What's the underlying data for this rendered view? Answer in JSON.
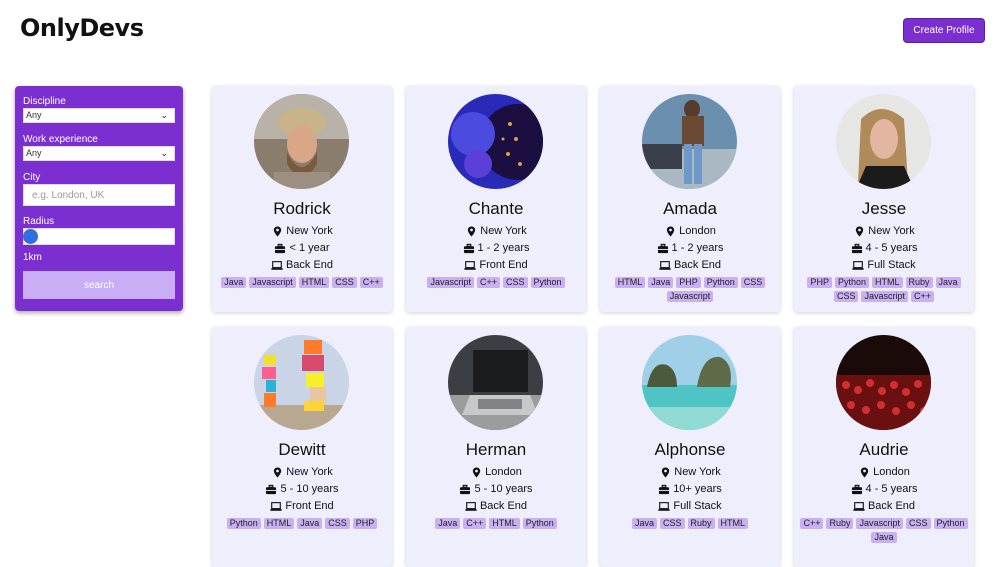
{
  "app": {
    "logo": "OnlyDevs",
    "create_button": "Create Profile"
  },
  "filters": {
    "discipline_label": "Discipline",
    "discipline_value": "Any",
    "experience_label": "Work experience",
    "experience_value": "Any",
    "city_label": "City",
    "city_placeholder": "e.g. London, UK",
    "radius_label": "Radius",
    "radius_value": "1km",
    "radius_slider_fraction": 0.0,
    "search_button": "search"
  },
  "colors": {
    "accent": "#7b2fd0",
    "card_bg": "#eeeefd",
    "tag_bg": "#c9b0f2",
    "search_disabled": "#c9adf5",
    "slider_knob": "#2f6fe0"
  },
  "icons": {
    "location": "map-pin-icon",
    "experience": "briefcase-icon",
    "discipline": "laptop-icon",
    "dropdown": "chevron-down-icon"
  },
  "profiles": [
    {
      "name": "Rodrick",
      "city": "New York",
      "experience": "< 1 year",
      "discipline": "Back End",
      "skills": [
        "Java",
        "Javascript",
        "HTML",
        "CSS",
        "C++"
      ],
      "avatar": "man-bucket-hat"
    },
    {
      "name": "Chante",
      "city": "New York",
      "experience": "1 - 2 years",
      "discipline": "Front End",
      "skills": [
        "Javascript",
        "C++",
        "CSS",
        "Python"
      ],
      "avatar": "blue-abstract-pattern"
    },
    {
      "name": "Amada",
      "city": "London",
      "experience": "1 - 2 years",
      "discipline": "Back End",
      "skills": [
        "HTML",
        "Java",
        "PHP",
        "Python",
        "CSS",
        "Javascript"
      ],
      "avatar": "person-by-car"
    },
    {
      "name": "Jesse",
      "city": "New York",
      "experience": "4 - 5 years",
      "discipline": "Full Stack",
      "skills": [
        "PHP",
        "Python",
        "HTML",
        "Ruby",
        "Java",
        "CSS",
        "Javascript",
        "C++"
      ],
      "avatar": "long-haired-person"
    },
    {
      "name": "Dewitt",
      "city": "New York",
      "experience": "5 - 10 years",
      "discipline": "Front End",
      "skills": [
        "Python",
        "HTML",
        "Java",
        "CSS",
        "PHP"
      ],
      "avatar": "colorful-rock-sculptures"
    },
    {
      "name": "Herman",
      "city": "London",
      "experience": "5 - 10 years",
      "discipline": "Back End",
      "skills": [
        "Java",
        "C++",
        "HTML",
        "Python"
      ],
      "avatar": "laptop-on-desk"
    },
    {
      "name": "Alphonse",
      "city": "New York",
      "experience": "10+ years",
      "discipline": "Full Stack",
      "skills": [
        "Java",
        "CSS",
        "Ruby",
        "HTML"
      ],
      "avatar": "tropical-bay"
    },
    {
      "name": "Audrie",
      "city": "London",
      "experience": "4 - 5 years",
      "discipline": "Back End",
      "skills": [
        "C++",
        "Ruby",
        "Javascript",
        "CSS",
        "Python",
        "Java"
      ],
      "avatar": "concert-crowd"
    }
  ]
}
